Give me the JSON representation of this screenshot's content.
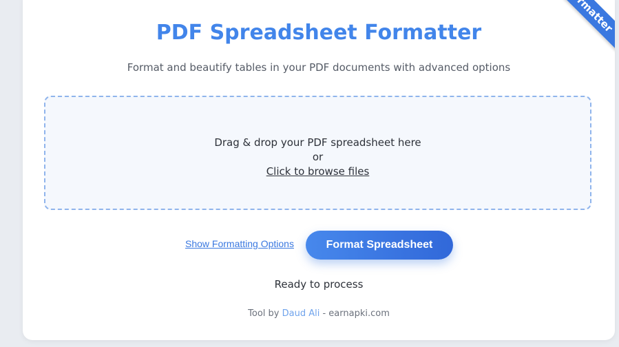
{
  "ribbon": {
    "label": "Formatter"
  },
  "header": {
    "title": "PDF Spreadsheet Formatter",
    "subtitle": "Format and beautify tables in your PDF documents with advanced options"
  },
  "dropzone": {
    "line1": "Drag & drop your PDF spreadsheet here",
    "line2": "or",
    "browse_label": "Click to browse files"
  },
  "actions": {
    "options_label": "Show Formatting Options",
    "format_label": "Format Spreadsheet"
  },
  "status": {
    "text": "Ready to process"
  },
  "footer": {
    "prefix": "Tool by ",
    "author": "Daud Ali",
    "suffix": " - earnapki.com"
  },
  "colors": {
    "accent": "#4285ea",
    "button": "#3a78e0",
    "dropzone_border": "#8fb4ec"
  }
}
